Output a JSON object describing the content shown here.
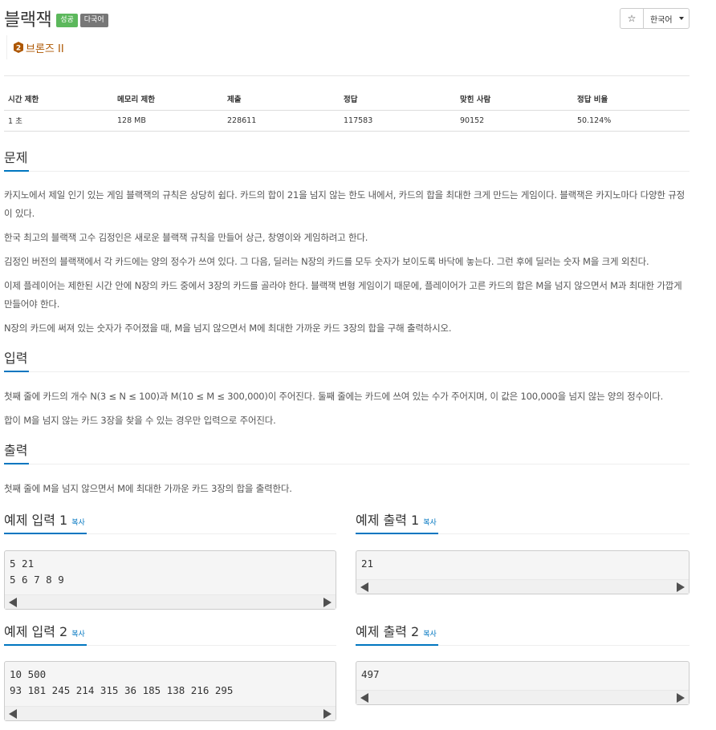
{
  "header": {
    "title": "블랙잭",
    "badge_success": "성공",
    "badge_lang": "다국어",
    "star": "☆",
    "language": "한국어",
    "tier": "브론즈 II",
    "tier_number": "2",
    "tier_color": "#ad5600"
  },
  "stats": {
    "headers": [
      "시간 제한",
      "메모리 제한",
      "제출",
      "정답",
      "맞힌 사람",
      "정답 비율"
    ],
    "values": [
      "1 초",
      "128 MB",
      "228611",
      "117583",
      "90152",
      "50.124%"
    ]
  },
  "problem": {
    "heading": "문제",
    "paragraphs": [
      "카지노에서 제일 인기 있는 게임 블랙잭의 규칙은 상당히 쉽다. 카드의 합이 21을 넘지 않는 한도 내에서, 카드의 합을 최대한 크게 만드는 게임이다. 블랙잭은 카지노마다 다양한 규정이 있다.",
      "한국 최고의 블랙잭 고수 김정인은 새로운 블랙잭 규칙을 만들어 상근, 창영이와 게임하려고 한다.",
      "김정인 버전의 블랙잭에서 각 카드에는 양의 정수가 쓰여 있다. 그 다음, 딜러는 N장의 카드를 모두 숫자가 보이도록 바닥에 놓는다. 그런 후에 딜러는 숫자 M을 크게 외친다.",
      "이제 플레이어는 제한된 시간 안에 N장의 카드 중에서 3장의 카드를 골라야 한다. 블랙잭 변형 게임이기 때문에, 플레이어가 고른 카드의 합은 M을 넘지 않으면서 M과 최대한 가깝게 만들어야 한다.",
      "N장의 카드에 써져 있는 숫자가 주어졌을 때, M을 넘지 않으면서 M에 최대한 가까운 카드 3장의 합을 구해 출력하시오."
    ]
  },
  "input": {
    "heading": "입력",
    "paragraphs": [
      "첫째 줄에 카드의 개수 N(3 ≤ N ≤ 100)과 M(10 ≤ M ≤ 300,000)이 주어진다. 둘째 줄에는 카드에 쓰여 있는 수가 주어지며, 이 값은 100,000을 넘지 않는 양의 정수이다.",
      "합이 M을 넘지 않는 카드 3장을 찾을 수 있는 경우만 입력으로 주어진다."
    ]
  },
  "output": {
    "heading": "출력",
    "paragraphs": [
      "첫째 줄에 M을 넘지 않으면서 M에 최대한 가까운 카드 3장의 합을 출력한다."
    ]
  },
  "samples": {
    "copy_label": "복사",
    "input1_title": "예제 입력 1",
    "input1": "5 21\n5 6 7 8 9",
    "output1_title": "예제 출력 1",
    "output1": "21",
    "input2_title": "예제 입력 2",
    "input2": "10 500\n93 181 245 214 315 36 185 138 216 295",
    "output2_title": "예제 출력 2",
    "output2": "497"
  }
}
